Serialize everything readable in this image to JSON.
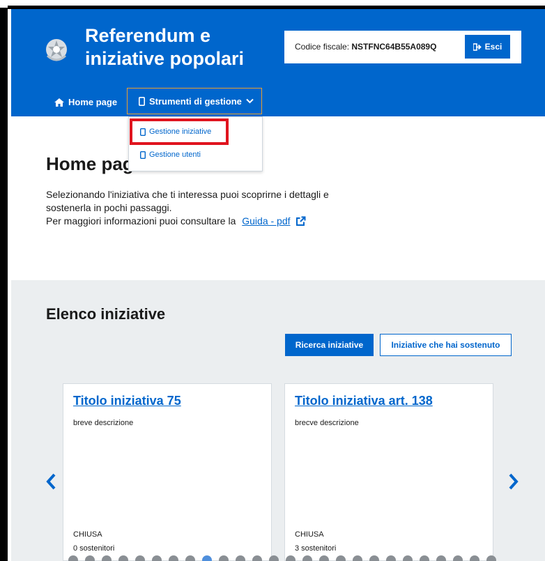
{
  "header": {
    "title_line1": "Referendum e",
    "title_line2": "iniziative popolari",
    "fiscal_code_label": "Codice fiscale:",
    "fiscal_code_value": "NSTFNC64B55A089Q",
    "exit_label": "Esci"
  },
  "nav": {
    "home_label": "Home page",
    "tools_label": "Strumenti di gestione",
    "dropdown": [
      {
        "label": "Gestione iniziative"
      },
      {
        "label": "Gestione utenti"
      }
    ]
  },
  "main": {
    "page_title": "Home page",
    "intro_line1": "Selezionando l'iniziativa che ti interessa puoi scoprirne i dettagli e",
    "intro_line2": "sostenerla in pochi passaggi.",
    "intro_line3": "Per maggiori informazioni puoi consultare la",
    "guide_link": "Guida - pdf"
  },
  "initiatives": {
    "section_title": "Elenco iniziative",
    "search_button": "Ricerca iniziative",
    "supported_button": "Iniziative che hai sostenuto",
    "cards": [
      {
        "title": "Titolo iniziativa 75",
        "description": "breve descrizione",
        "status": "CHIUSA",
        "supporters": "0 sostenitori"
      },
      {
        "title": "Titolo iniziativa art. 138",
        "description": "brecve descrizione",
        "status": "CHIUSA",
        "supporters": "3 sostenitori"
      }
    ],
    "carousel": {
      "total_dots": 27,
      "active_dot": 8
    }
  },
  "colors": {
    "primary": "#0066cc",
    "highlight": "#e0141e",
    "section_bg": "#ebeef0"
  }
}
